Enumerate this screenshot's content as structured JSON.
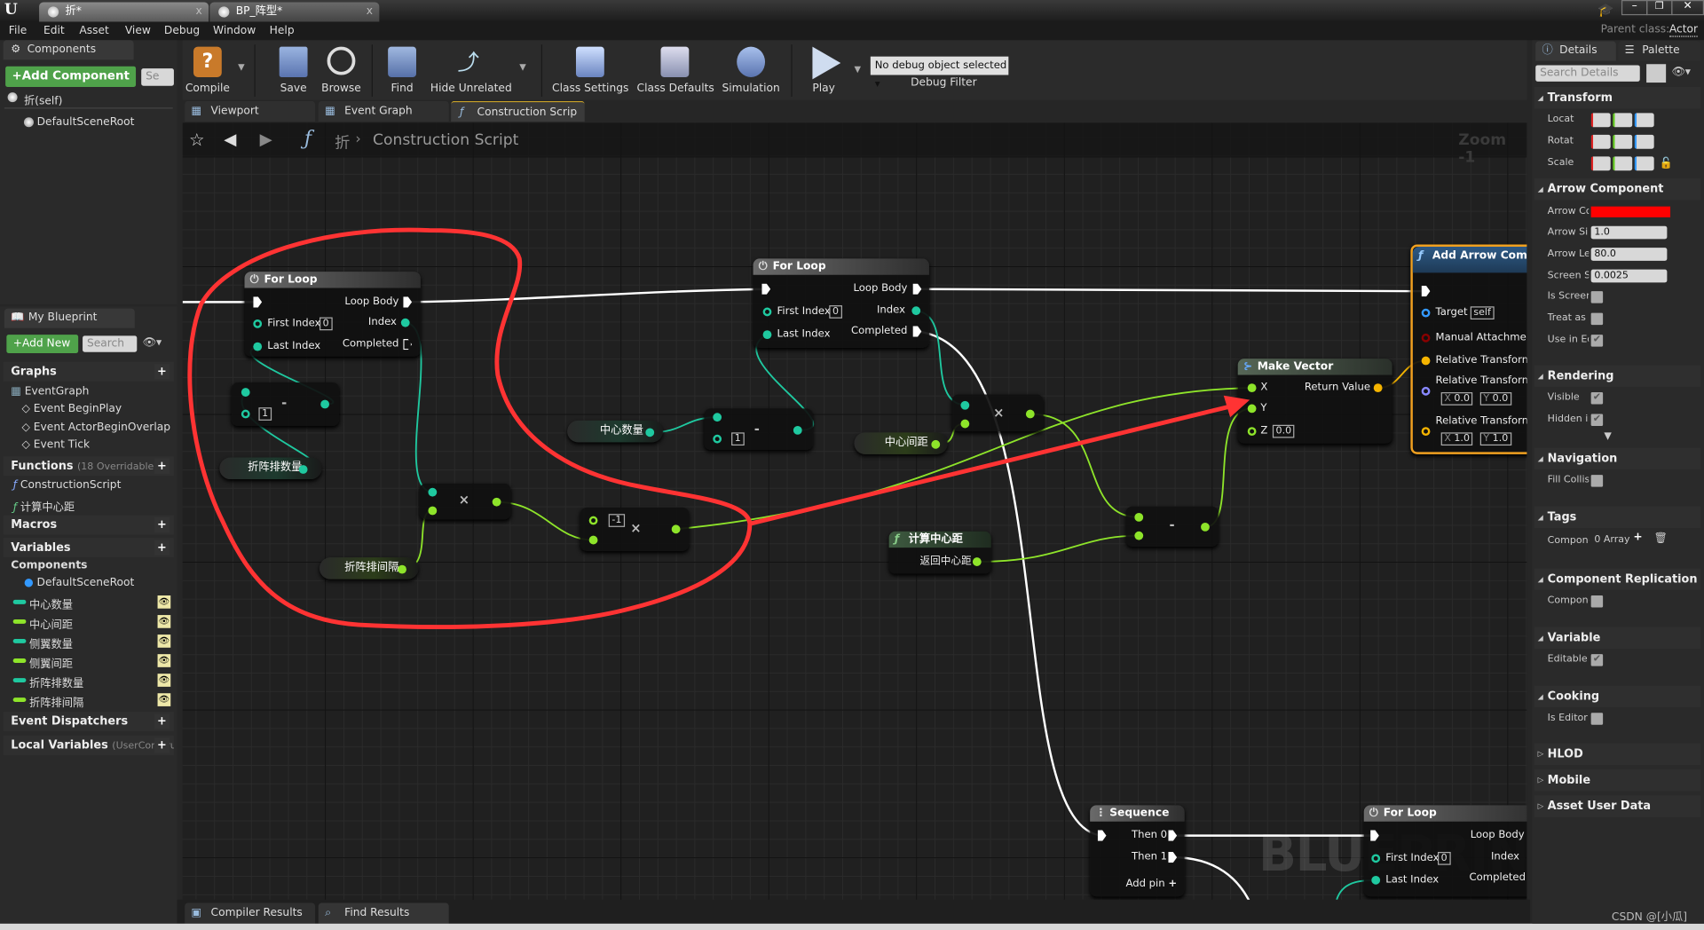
{
  "window": {
    "tabs": [
      {
        "label": "折*"
      },
      {
        "label": "BP_阵型*"
      }
    ],
    "parent_class_label": "Parent class:",
    "parent_class_value": "Actor",
    "menu": [
      "File",
      "Edit",
      "Asset",
      "View",
      "Debug",
      "Window",
      "Help"
    ]
  },
  "components_panel": {
    "tab": "Components",
    "add_button": "+Add Component",
    "search_placeholder": "Se",
    "self_item": "折(self)",
    "root_item": "DefaultSceneRoot"
  },
  "toolbar": {
    "buttons": [
      "Compile",
      "Save",
      "Browse",
      "Find",
      "Hide Unrelated",
      "Class Settings",
      "Class Defaults",
      "Simulation",
      "Play"
    ],
    "debug_select": "No debug object selected",
    "debug_filter_label": "Debug Filter"
  },
  "editor_tabs": [
    {
      "label": "Viewport"
    },
    {
      "label": "Event Graph"
    },
    {
      "label": "Construction Scrip",
      "active": true
    }
  ],
  "breadcrumb": {
    "root": "折",
    "current": "Construction Script",
    "zoom": "Zoom -1"
  },
  "my_blueprint": {
    "tab": "My Blueprint",
    "add_button": "+Add New",
    "search_placeholder": "Search",
    "graphs_header": "Graphs",
    "event_graph": "EventGraph",
    "events": [
      "Event BeginPlay",
      "Event ActorBeginOverlap",
      "Event Tick"
    ],
    "functions_header": "Functions",
    "functions_note": "(18 Overridable)",
    "functions": [
      "ConstructionScript",
      "计算中心距"
    ],
    "macros_header": "Macros",
    "variables_header": "Variables",
    "components_header": "Components",
    "component_root": "DefaultSceneRoot",
    "variables": [
      {
        "name": "中心数量",
        "type": "int",
        "color": "#1fc9a0"
      },
      {
        "name": "中心间距",
        "type": "float",
        "color": "#8ee42a"
      },
      {
        "name": "侧翼数量",
        "type": "int",
        "color": "#1fc9a0"
      },
      {
        "name": "侧翼间距",
        "type": "float",
        "color": "#8ee42a"
      },
      {
        "name": "折阵排数量",
        "type": "int",
        "color": "#1fc9a0"
      },
      {
        "name": "折阵排间隔",
        "type": "float",
        "color": "#8ee42a"
      }
    ],
    "dispatchers_header": "Event Dispatchers",
    "local_vars_header": "Local Variables",
    "local_vars_note": "(UserConstruc"
  },
  "graph": {
    "for_loop": {
      "title": "For Loop",
      "loop_body": "Loop Body",
      "first_index": "First Index",
      "first_index_value": "0",
      "index": "Index",
      "last_index": "Last Index",
      "completed": "Completed"
    },
    "minus_op": "-",
    "multiply_op": "×",
    "literal_one": "1",
    "literal_neg_one": "-1",
    "var_nodes": {
      "rows_count": "折阵排数量",
      "rows_gap": "折阵排间隔",
      "center_count": "中心数量",
      "center_gap": "中心间距"
    },
    "calc_center_node": {
      "title": "计算中心距",
      "output": "返回中心距"
    },
    "make_vector": {
      "title": "Make Vector",
      "x": "X",
      "y": "Y",
      "z": "Z",
      "z_value": "0.0",
      "return": "Return Value"
    },
    "add_arrow": {
      "title": "Add Arrow Compor",
      "target": "Target",
      "target_value": "self",
      "manual": "Manual Attachment",
      "rel1": "Relative Transform",
      "rel2": "Relative Transform",
      "rel3": "Relative Transform",
      "x_label": "X",
      "y_label": "Y",
      "loc_x": "0.0",
      "loc_y": "0.0",
      "scale_x": "1.0",
      "scale_y": "1.0"
    },
    "sequence": {
      "title": "Sequence",
      "then0": "Then 0",
      "then1": "Then 1",
      "add_pin": "Add pin"
    },
    "watermark": "BLUEPRINT",
    "colors": {
      "int": "#1fc9a0",
      "float": "#8ee42a",
      "struct": "#f5b400",
      "exec": "#ffffff",
      "annotation": "#ff3333"
    }
  },
  "bottom_tabs": [
    {
      "label": "Compiler Results"
    },
    {
      "label": "Find Results"
    }
  ],
  "details": {
    "tabs": [
      "Details",
      "Palette"
    ],
    "search_placeholder": "Search Details",
    "transform": {
      "header": "Transform",
      "location": "Locat",
      "rotation": "Rotat",
      "scale": "Scale"
    },
    "arrow_component": {
      "header": "Arrow Component",
      "arrow_color_label": "Arrow Cc",
      "arrow_color": "#ff0000",
      "arrow_size_label": "Arrow Si",
      "arrow_size": "1.0",
      "arrow_length_label": "Arrow Le",
      "arrow_length": "80.0",
      "screen_size_label": "Screen S",
      "screen_size": "0.0025",
      "is_screen_label": "Is Screer",
      "is_screen": false,
      "treat_as_label": "Treat as",
      "treat_as": false,
      "use_in_label": "Use in Ec",
      "use_in": true
    },
    "rendering": {
      "header": "Rendering",
      "visible_label": "Visible",
      "visible": true,
      "hidden_label": "Hidden ir",
      "hidden": true
    },
    "navigation": {
      "header": "Navigation",
      "fill_label": "Fill Collis",
      "fill": false
    },
    "tags": {
      "header": "Tags",
      "label": "Compone",
      "value": "0 Array"
    },
    "replication": {
      "header": "Component Replication",
      "label": "Compone",
      "value": false
    },
    "variable": {
      "header": "Variable",
      "label": "Editable",
      "value": true
    },
    "cooking": {
      "header": "Cooking",
      "label": "Is Editor",
      "value": false
    },
    "collapsed": [
      "HLOD",
      "Mobile",
      "Asset User Data"
    ]
  },
  "watermark_credit": "CSDN @[小瓜]"
}
